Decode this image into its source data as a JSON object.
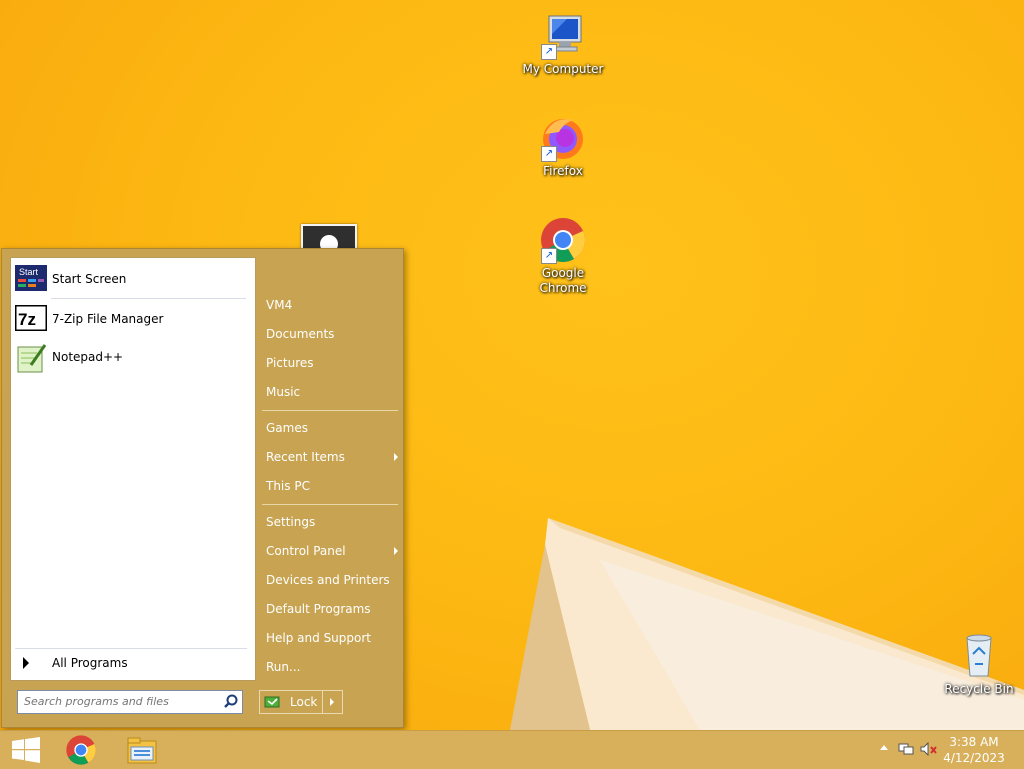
{
  "desktop": {
    "icons": [
      {
        "label": "My Computer",
        "icon": "my-computer-icon"
      },
      {
        "label": "Firefox",
        "icon": "firefox-icon"
      },
      {
        "label": "Google\nChrome",
        "line1": "Google",
        "line2": "Chrome",
        "icon": "chrome-icon"
      },
      {
        "label": "Recycle Bin",
        "icon": "recycle-bin-icon"
      }
    ]
  },
  "start_menu": {
    "programs": [
      {
        "label": "Start Screen",
        "icon": "start-screen-icon",
        "icon_text": "Start"
      },
      {
        "label": "7-Zip File Manager",
        "icon": "7zip-icon",
        "icon_text": "7z"
      },
      {
        "label": "Notepad++",
        "icon": "notepadpp-icon"
      }
    ],
    "all_programs": "All Programs",
    "search_placeholder": "Search programs and files",
    "right_items": [
      {
        "label": "VM4"
      },
      {
        "label": "Documents"
      },
      {
        "label": "Pictures"
      },
      {
        "label": "Music"
      },
      {
        "label": "Games"
      },
      {
        "label": "Recent Items",
        "submenu": true
      },
      {
        "label": "This PC"
      },
      {
        "label": "Settings"
      },
      {
        "label": "Control Panel",
        "submenu": true
      },
      {
        "label": "Devices and Printers"
      },
      {
        "label": "Default Programs"
      },
      {
        "label": "Help and Support"
      },
      {
        "label": "Run..."
      }
    ],
    "lock_label": "Lock"
  },
  "taskbar": {
    "apps": [
      {
        "name": "start-button",
        "icon": "windows-logo-icon"
      },
      {
        "name": "chrome",
        "icon": "chrome-icon"
      },
      {
        "name": "file-explorer",
        "icon": "file-explorer-icon"
      }
    ],
    "tray_icons": [
      "show-hidden-icons",
      "network-icon",
      "volume-muted-icon"
    ],
    "time": "3:38 AM",
    "date": "4/12/2023"
  },
  "colors": {
    "wallpaper": "#fdb913",
    "start_menu_bg": "#c8a452",
    "taskbar_bg": "#d6b060"
  }
}
